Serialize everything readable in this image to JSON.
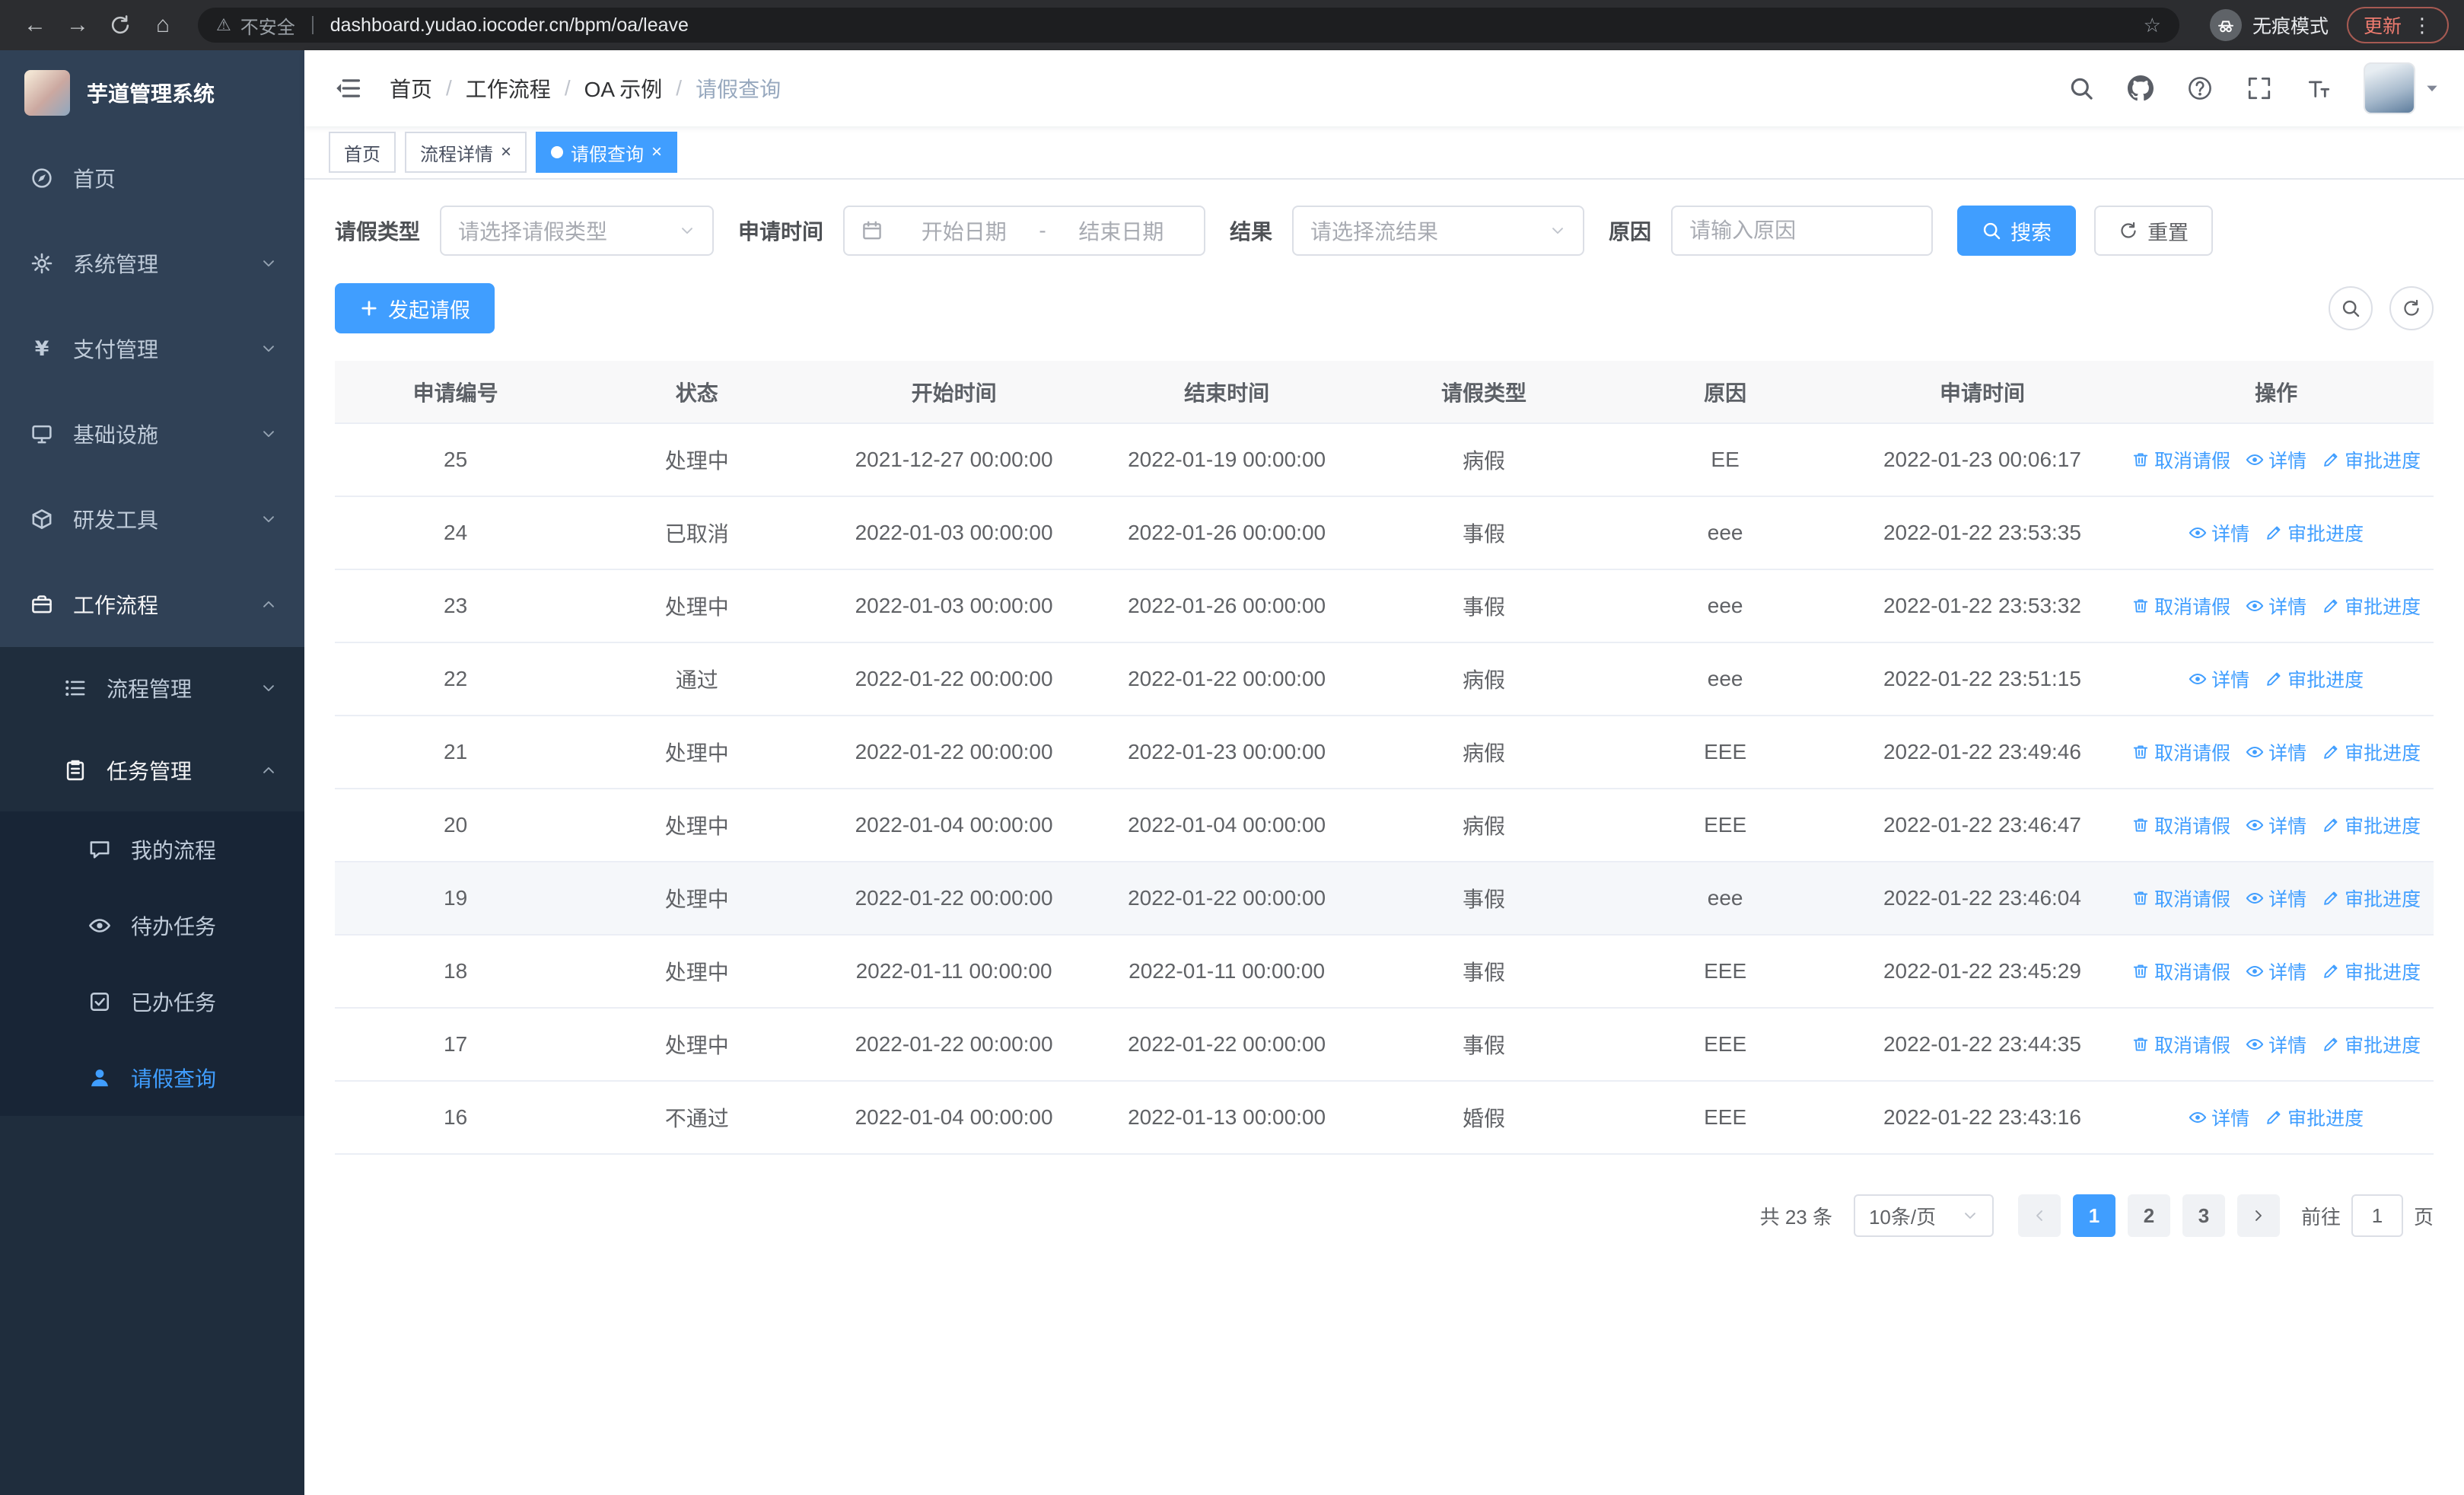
{
  "accent_color": "#409eff",
  "browser": {
    "security_label": "不安全",
    "url": "dashboard.yudao.iocoder.cn/bpm/oa/leave",
    "incognito_label": "无痕模式",
    "update_label": "更新"
  },
  "sidebar": {
    "logo_title": "芋道管理系统",
    "items": [
      {
        "key": "home",
        "icon": "home",
        "label": "首页"
      },
      {
        "key": "system-management",
        "icon": "gear",
        "label": "系统管理",
        "chevron": "down"
      },
      {
        "key": "payment-management",
        "icon": "yen",
        "label": "支付管理",
        "chevron": "down"
      },
      {
        "key": "infrastructure",
        "icon": "monitor",
        "label": "基础设施",
        "chevron": "down"
      },
      {
        "key": "dev-tools",
        "icon": "cube",
        "label": "研发工具",
        "chevron": "down"
      },
      {
        "key": "workflow",
        "icon": "briefcase",
        "label": "工作流程",
        "chevron": "up",
        "expanded": true
      }
    ],
    "workflow_children": [
      {
        "key": "process-management",
        "icon": "list",
        "label": "流程管理",
        "chevron": "down"
      },
      {
        "key": "task-management",
        "icon": "clipboard",
        "label": "任务管理",
        "chevron": "up",
        "expanded": true
      }
    ],
    "task_children": [
      {
        "key": "my-processes",
        "icon": "chat",
        "label": "我的流程"
      },
      {
        "key": "todo-tasks",
        "icon": "eye",
        "label": "待办任务"
      },
      {
        "key": "done-tasks",
        "icon": "check-square",
        "label": "已办任务"
      },
      {
        "key": "leave-query",
        "icon": "user",
        "label": "请假查询",
        "active": true
      }
    ]
  },
  "navbar": {
    "breadcrumb": [
      "首页",
      "工作流程",
      "OA 示例",
      "请假查询"
    ]
  },
  "tags": [
    {
      "label": "首页",
      "closable": false,
      "active": false
    },
    {
      "label": "流程详情",
      "closable": true,
      "active": false
    },
    {
      "label": "请假查询",
      "closable": true,
      "active": true
    }
  ],
  "filters": {
    "leave_type_label": "请假类型",
    "leave_type_placeholder": "请选择请假类型",
    "apply_time_label": "申请时间",
    "start_date_placeholder": "开始日期",
    "range_separator": "-",
    "end_date_placeholder": "结束日期",
    "result_label": "结果",
    "result_placeholder": "请选择流结果",
    "reason_label": "原因",
    "reason_placeholder": "请输入原因",
    "search_button": "搜索",
    "reset_button": "重置"
  },
  "toolbar": {
    "create_button": "发起请假"
  },
  "table": {
    "columns": [
      "申请编号",
      "状态",
      "开始时间",
      "结束时间",
      "请假类型",
      "原因",
      "申请时间",
      "操作"
    ],
    "action_labels": {
      "cancel": "取消请假",
      "detail": "详情",
      "progress": "审批进度"
    },
    "rows": [
      {
        "id": "25",
        "status": "处理中",
        "start": "2021-12-27 00:00:00",
        "end": "2022-01-19 00:00:00",
        "type": "病假",
        "reason": "EE",
        "applied": "2022-01-23 00:06:17",
        "actions": [
          "cancel",
          "detail",
          "progress"
        ]
      },
      {
        "id": "24",
        "status": "已取消",
        "start": "2022-01-03 00:00:00",
        "end": "2022-01-26 00:00:00",
        "type": "事假",
        "reason": "eee",
        "applied": "2022-01-22 23:53:35",
        "actions": [
          "detail",
          "progress"
        ]
      },
      {
        "id": "23",
        "status": "处理中",
        "start": "2022-01-03 00:00:00",
        "end": "2022-01-26 00:00:00",
        "type": "事假",
        "reason": "eee",
        "applied": "2022-01-22 23:53:32",
        "actions": [
          "cancel",
          "detail",
          "progress"
        ]
      },
      {
        "id": "22",
        "status": "通过",
        "start": "2022-01-22 00:00:00",
        "end": "2022-01-22 00:00:00",
        "type": "病假",
        "reason": "eee",
        "applied": "2022-01-22 23:51:15",
        "actions": [
          "detail",
          "progress"
        ]
      },
      {
        "id": "21",
        "status": "处理中",
        "start": "2022-01-22 00:00:00",
        "end": "2022-01-23 00:00:00",
        "type": "病假",
        "reason": "EEE",
        "applied": "2022-01-22 23:49:46",
        "actions": [
          "cancel",
          "detail",
          "progress"
        ]
      },
      {
        "id": "20",
        "status": "处理中",
        "start": "2022-01-04 00:00:00",
        "end": "2022-01-04 00:00:00",
        "type": "病假",
        "reason": "EEE",
        "applied": "2022-01-22 23:46:47",
        "actions": [
          "cancel",
          "detail",
          "progress"
        ]
      },
      {
        "id": "19",
        "status": "处理中",
        "start": "2022-01-22 00:00:00",
        "end": "2022-01-22 00:00:00",
        "type": "事假",
        "reason": "eee",
        "applied": "2022-01-22 23:46:04",
        "actions": [
          "cancel",
          "detail",
          "progress"
        ],
        "hover": true
      },
      {
        "id": "18",
        "status": "处理中",
        "start": "2022-01-11 00:00:00",
        "end": "2022-01-11 00:00:00",
        "type": "事假",
        "reason": "EEE",
        "applied": "2022-01-22 23:45:29",
        "actions": [
          "cancel",
          "detail",
          "progress"
        ]
      },
      {
        "id": "17",
        "status": "处理中",
        "start": "2022-01-22 00:00:00",
        "end": "2022-01-22 00:00:00",
        "type": "事假",
        "reason": "EEE",
        "applied": "2022-01-22 23:44:35",
        "actions": [
          "cancel",
          "detail",
          "progress"
        ]
      },
      {
        "id": "16",
        "status": "不通过",
        "start": "2022-01-04 00:00:00",
        "end": "2022-01-13 00:00:00",
        "type": "婚假",
        "reason": "EEE",
        "applied": "2022-01-22 23:43:16",
        "actions": [
          "detail",
          "progress"
        ]
      }
    ]
  },
  "pagination": {
    "total_label": "共 23 条",
    "page_size": "10条/页",
    "pages": [
      "1",
      "2",
      "3"
    ],
    "active_page": "1",
    "goto_label": "前往",
    "goto_value": "1",
    "page_unit": "页"
  }
}
